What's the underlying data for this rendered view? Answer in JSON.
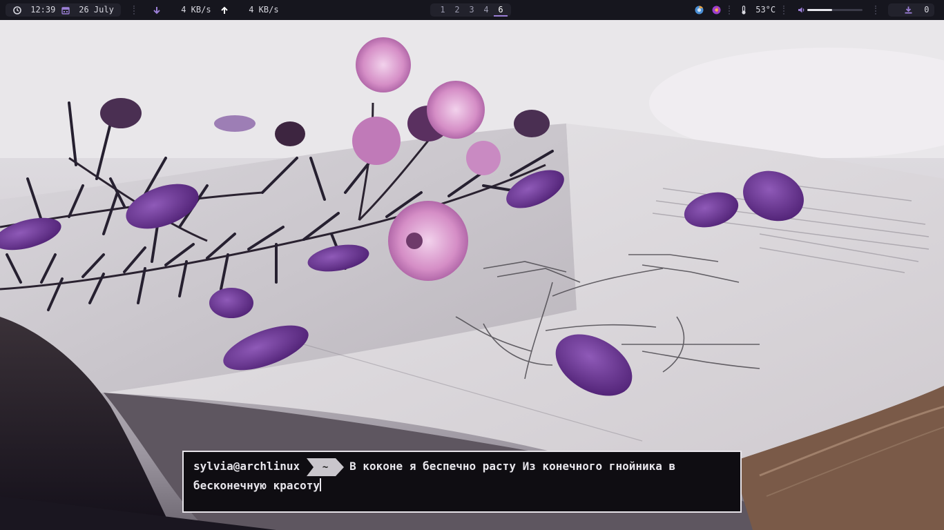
{
  "topbar": {
    "clock": {
      "icon": "clock-icon",
      "time": "12:39"
    },
    "date": {
      "icon": "calendar-icon",
      "value": "26 July"
    },
    "network": {
      "down_icon": "arrow-down-icon",
      "down": "4 KB/s",
      "up_icon": "arrow-up-icon",
      "up": "4 KB/s"
    },
    "workspaces": [
      {
        "label": "1",
        "active": false
      },
      {
        "label": "2",
        "active": false
      },
      {
        "label": "3",
        "active": false
      },
      {
        "label": "4",
        "active": false
      },
      {
        "label": "6",
        "active": true
      }
    ],
    "tray": [
      "chromium-icon",
      "firefox-icon"
    ],
    "temperature": {
      "icon": "thermometer-icon",
      "value": "53°C"
    },
    "volume": {
      "icon": "speaker-icon",
      "level": 0.45
    },
    "updates": {
      "icon": "download-icon",
      "count": "0"
    },
    "colors": {
      "bar": "#16161e",
      "pill": "#22222c",
      "accent": "#9b7fd6"
    }
  },
  "terminal": {
    "user": "sylvia@archlinux",
    "dir": "~",
    "line1": "В коконе я беспечно расту Из конечного гнойника в",
    "line2": "бесконечную красоту"
  }
}
